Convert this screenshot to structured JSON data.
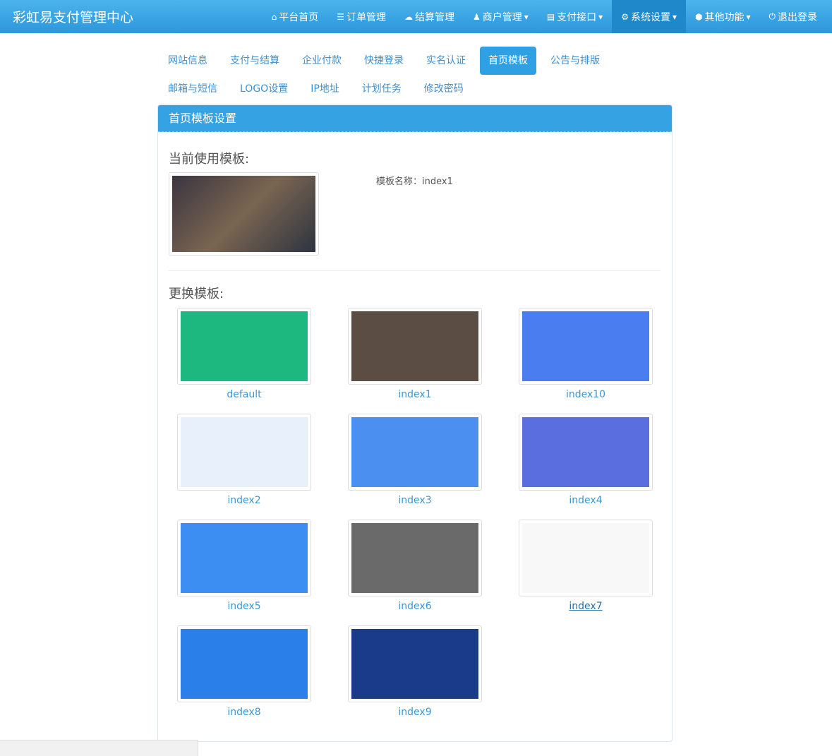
{
  "brand": "彩虹易支付管理中心",
  "nav": [
    {
      "label": "平台首页",
      "icon": "home-icon",
      "glyph": "⌂",
      "caret": false
    },
    {
      "label": "订单管理",
      "icon": "list-icon",
      "glyph": "☰",
      "caret": false
    },
    {
      "label": "结算管理",
      "icon": "cloud-icon",
      "glyph": "☁",
      "caret": false
    },
    {
      "label": "商户管理",
      "icon": "user-icon",
      "glyph": "♟",
      "caret": true
    },
    {
      "label": "支付接口",
      "icon": "credit-card-icon",
      "glyph": "▤",
      "caret": true
    },
    {
      "label": "系统设置",
      "icon": "gear-icon",
      "glyph": "⚙",
      "caret": true,
      "active": true
    },
    {
      "label": "其他功能",
      "icon": "cube-icon",
      "glyph": "⬢",
      "caret": true
    },
    {
      "label": "退出登录",
      "icon": "power-icon",
      "glyph": "⏻",
      "caret": false
    }
  ],
  "tabs_row1": [
    "网站信息",
    "支付与结算",
    "企业付款",
    "快捷登录",
    "实名认证",
    "首页模板",
    "公告与排版"
  ],
  "tabs_row2": [
    "邮箱与短信",
    "LOGO设置",
    "IP地址",
    "计划任务",
    "修改密码"
  ],
  "active_tab": "首页模板",
  "panel_title": "首页模板设置",
  "current_heading": "当前使用模板:",
  "current_name_label": "模板名称：index1",
  "change_heading": "更换模板:",
  "templates": [
    {
      "name": "default",
      "color": "#1cb87f"
    },
    {
      "name": "index1",
      "color": "#5b4c44"
    },
    {
      "name": "index10",
      "color": "#4a7ef0"
    },
    {
      "name": "index2",
      "color": "#e8f0fb"
    },
    {
      "name": "index3",
      "color": "#4b8ff0"
    },
    {
      "name": "index4",
      "color": "#5a6ee0"
    },
    {
      "name": "index5",
      "color": "#3d8ef2"
    },
    {
      "name": "index6",
      "color": "#6a6a6a"
    },
    {
      "name": "index7",
      "color": "#f8f8f8",
      "hovered": true
    },
    {
      "name": "index8",
      "color": "#2a7fe8"
    },
    {
      "name": "index9",
      "color": "#1a3a8a"
    }
  ]
}
